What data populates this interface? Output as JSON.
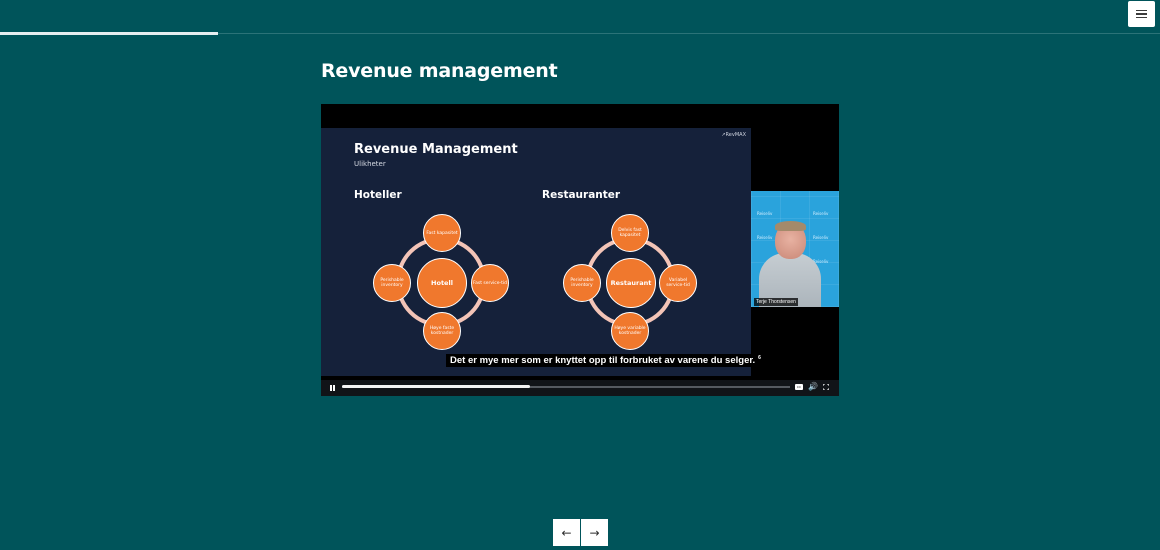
{
  "progress": {
    "fraction": 0.188
  },
  "menu": {
    "icon": "hamburger-menu-icon"
  },
  "page": {
    "title": "Revenue management"
  },
  "slide": {
    "logo": "↗RevMAX",
    "title": "Revenue Management",
    "subtitle": "Ulikheter",
    "columns": [
      {
        "title": "Hoteller",
        "center": "Hotell",
        "top": "Fast kapasitet",
        "left": "Perishable inventory",
        "right": "Fast service-tid",
        "bottom": "Høye faste kostnader"
      },
      {
        "title": "Restauranter",
        "center": "Restaurant",
        "top": "Delvis fast kapasitet",
        "left": "Perishable inventory",
        "right": "Variabel service-tid",
        "bottom": "Høye variable kostnader"
      }
    ]
  },
  "caption": {
    "text": "Det er mye mer som er knyttet opp til forbruket av varene du selger.",
    "mark": "6"
  },
  "webcam": {
    "brand": "Reiseliv",
    "name": "Terje Thorstensen"
  },
  "video": {
    "played_fraction": 0.42,
    "state": "playing",
    "cc_label": "CC"
  },
  "nav": {
    "prev_icon": "←",
    "next_icon": "→"
  },
  "colors": {
    "background": "#00545a",
    "slide_bg": "#15213a",
    "node": "#f0782d",
    "ring": "#f3c4b7"
  }
}
